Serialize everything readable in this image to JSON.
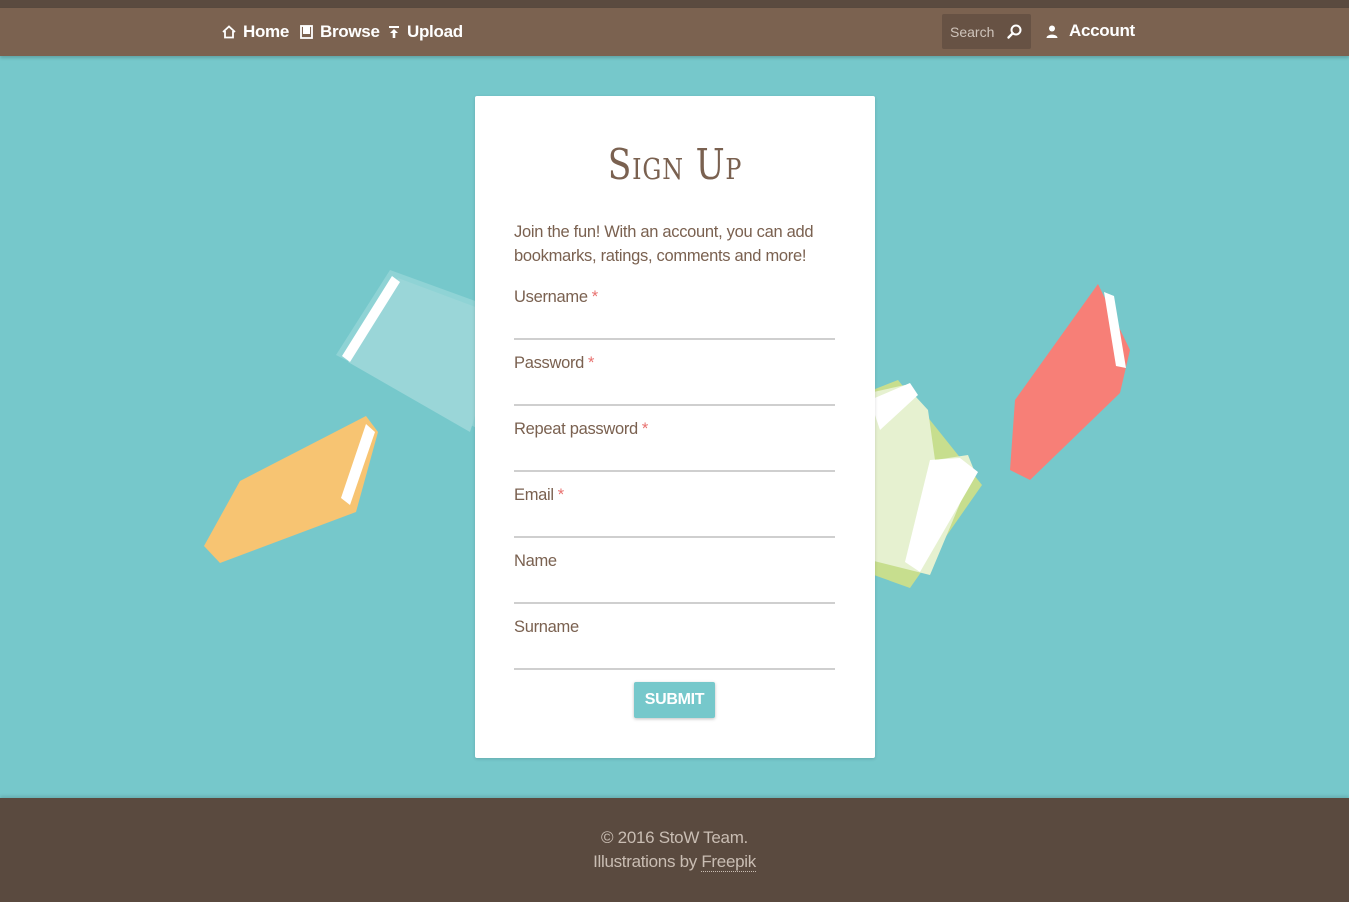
{
  "nav": {
    "home_label": "Home",
    "browse_label": "Browse",
    "upload_label": "Upload",
    "search_placeholder": "Search",
    "account_label": "Account"
  },
  "form": {
    "title": "Sign Up",
    "intro": "Join the fun! With an account, you can add bookmarks, ratings, comments and more!",
    "fields": [
      {
        "label": "Username",
        "required": true
      },
      {
        "label": "Password",
        "required": true
      },
      {
        "label": "Repeat password",
        "required": true
      },
      {
        "label": "Email",
        "required": true
      },
      {
        "label": "Name",
        "required": false
      },
      {
        "label": "Surname",
        "required": false
      }
    ],
    "required_marker": "*",
    "submit_label": "SUBMIT"
  },
  "footer": {
    "copyright": "© 2016 StoW Team.",
    "illustrations_prefix": "Illustrations by ",
    "illustrations_link": "Freepik"
  },
  "colors": {
    "background": "#76c8cb",
    "navbar": "#7b6250",
    "footer": "#5a4a3f",
    "accent_text": "#7a6150",
    "required": "#e8716f"
  },
  "icons": [
    "home-icon",
    "book-icon",
    "upload-icon",
    "search-icon",
    "user-icon"
  ]
}
